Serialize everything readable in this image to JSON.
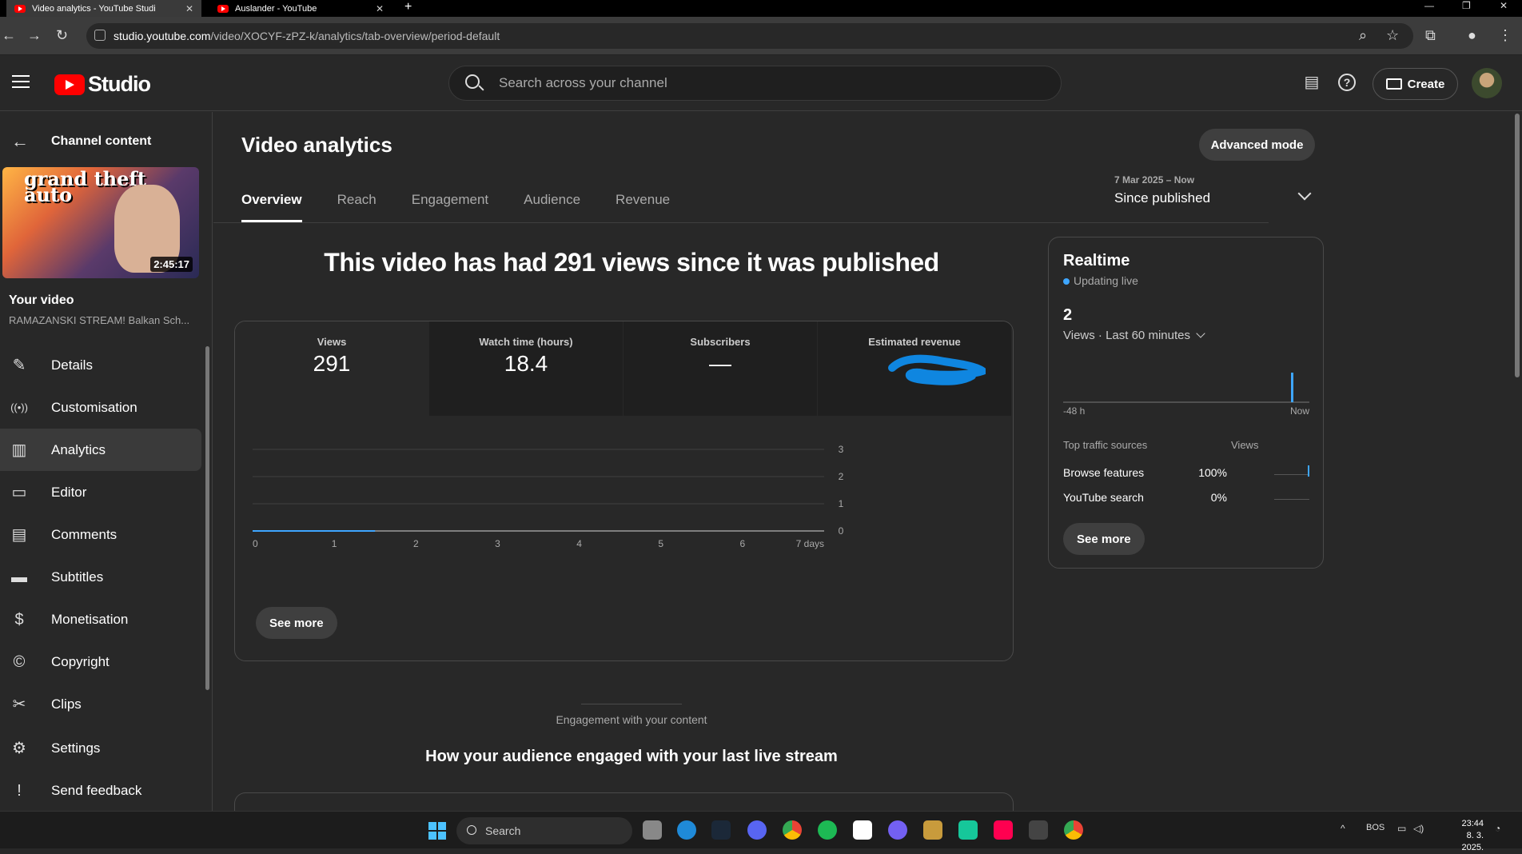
{
  "browser": {
    "tabs": [
      {
        "title": "Video analytics - YouTube Studi",
        "active": true
      },
      {
        "title": "Auslander - YouTube",
        "active": false
      }
    ],
    "url_host": "studio.youtube.com",
    "url_path": "/video/XOCYF-zPZ-k/analytics/tab-overview/period-default"
  },
  "header": {
    "logo_text": "Studio",
    "search_placeholder": "Search across your channel",
    "create_label": "Create"
  },
  "sidebar": {
    "back_label": "Channel content",
    "thumbnail_duration": "2:45:17",
    "thumbnail_text": "grand theft auto",
    "your_video_label": "Your video",
    "video_title": "RAMAZANSKI STREAM! Balkan Sch...",
    "items": [
      {
        "label": "Details",
        "icon": "pencil-icon",
        "active": false
      },
      {
        "label": "Customisation",
        "icon": "broadcast-icon",
        "active": false
      },
      {
        "label": "Analytics",
        "icon": "analytics-icon",
        "active": true
      },
      {
        "label": "Editor",
        "icon": "film-icon",
        "active": false
      },
      {
        "label": "Comments",
        "icon": "comment-icon",
        "active": false
      },
      {
        "label": "Subtitles",
        "icon": "subtitles-icon",
        "active": false
      },
      {
        "label": "Monetisation",
        "icon": "dollar-icon",
        "active": false
      },
      {
        "label": "Copyright",
        "icon": "copyright-icon",
        "active": false
      },
      {
        "label": "Clips",
        "icon": "scissors-icon",
        "active": false
      }
    ],
    "bottom_items": [
      {
        "label": "Settings",
        "icon": "gear-icon"
      },
      {
        "label": "Send feedback",
        "icon": "feedback-icon"
      }
    ]
  },
  "main": {
    "title": "Video analytics",
    "advanced_mode_label": "Advanced mode",
    "tabs": [
      "Overview",
      "Reach",
      "Engagement",
      "Audience",
      "Revenue"
    ],
    "period_range": "7 Mar 2025 – Now",
    "period_label": "Since published",
    "headline": "This video has had 291 views since it was published",
    "metrics": [
      {
        "label": "Views",
        "value": "291"
      },
      {
        "label": "Watch time (hours)",
        "value": "18.4"
      },
      {
        "label": "Subscribers",
        "value": "—"
      },
      {
        "label": "Estimated revenue",
        "value": ""
      }
    ],
    "see_more_label": "See more",
    "engagement_label": "Engagement with your content",
    "engagement_title": "How your audience engaged with your last live stream"
  },
  "chart_data": {
    "type": "line",
    "x_tick_labels": [
      "0",
      "1",
      "2",
      "3",
      "4",
      "5",
      "6",
      "7 days"
    ],
    "y_tick_labels": [
      "0",
      "1",
      "2",
      "3"
    ],
    "xlim": [
      0,
      7
    ],
    "ylim": [
      0,
      3
    ],
    "series": [
      {
        "x": [
          0,
          0.5,
          1,
          1.5
        ],
        "values": [
          0,
          0,
          0,
          0
        ]
      }
    ],
    "grid": true,
    "accent": "#3ea6ff"
  },
  "realtime": {
    "title": "Realtime",
    "status": "Updating live",
    "count": "2",
    "views_label": "Views · Last 60 minutes",
    "axis_start": "-48 h",
    "axis_end": "Now",
    "col_source": "Top traffic sources",
    "col_views": "Views",
    "sources": [
      {
        "name": "Browse features",
        "pct": "100%",
        "fraction": 1.0
      },
      {
        "name": "YouTube search",
        "pct": "0%",
        "fraction": 0.0
      }
    ],
    "see_more_label": "See more"
  },
  "taskbar": {
    "search_label": "Search",
    "language": "BOS",
    "time": "23:44",
    "date": "8. 3. 2025."
  }
}
